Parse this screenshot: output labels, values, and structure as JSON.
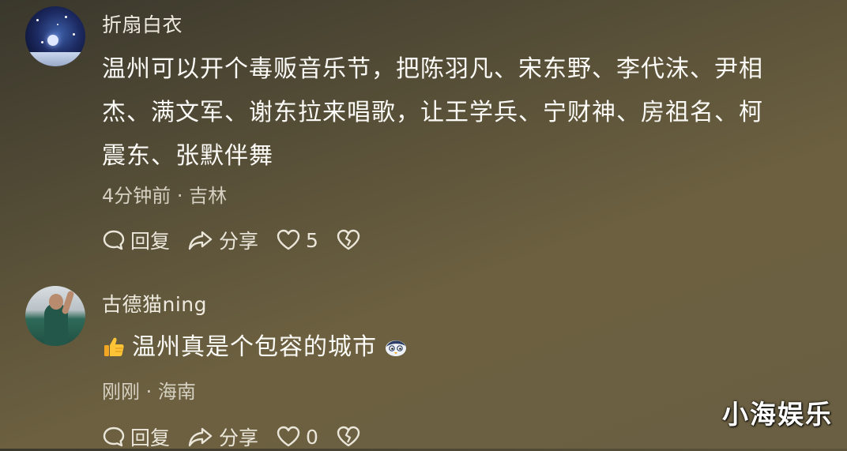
{
  "comments": [
    {
      "username": "折扇白衣",
      "avatar": "night-sky-avatar",
      "text_lines": [
        "温州可以开个毒贩音乐节，把陈羽凡、宋东野、李代沫、尹相",
        "杰、满文军、谢东拉来唱歌，让王学兵、宁财神、房祖名、柯",
        "震东、张默伴舞"
      ],
      "meta": "4分钟前 · 吉林",
      "reply_label": "回复",
      "share_label": "分享",
      "like_count": "5"
    },
    {
      "username": "古德猫ning",
      "avatar": "football-player-avatar",
      "text": "温州真是个包容的城市",
      "leading_emoji": "thumbs-up-emoji",
      "trailing_emoji": "bird-emoji",
      "meta": "刚刚 · 海南",
      "reply_label": "回复",
      "share_label": "分享",
      "like_count": "0"
    }
  ],
  "watermark": "小海娱乐",
  "colors": {
    "background": "#5e5539",
    "text": "#fbfaf6",
    "meta": "#d6d0c2"
  }
}
